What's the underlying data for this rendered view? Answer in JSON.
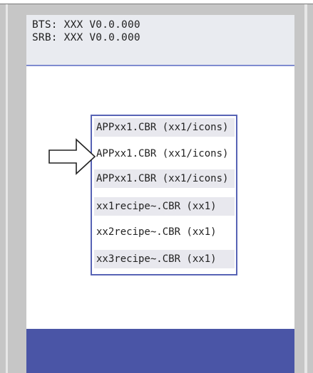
{
  "header": {
    "line1": "BTS: XXX V0.0.000",
    "line2": "SRB: XXX V0.0.000"
  },
  "file_list": {
    "items": [
      {
        "label": "APPxx1.CBR (xx1/icons)"
      },
      {
        "label": "APPxx1.CBR (xx1/icons)"
      },
      {
        "label": "APPxx1.CBR (xx1/icons)"
      },
      {
        "label": "xx1recipe~.CBR (xx1)"
      },
      {
        "label": "xx2recipe~.CBR (xx1)"
      },
      {
        "label": "xx3recipe~.CBR (xx1)"
      }
    ]
  },
  "pointer": {
    "icon": "arrow-right-icon"
  },
  "colors": {
    "accent": "#4a55a6",
    "header_bg": "#e9ebf0",
    "row_shade": "#e8e8ee",
    "frame": "#c6c6c6"
  }
}
